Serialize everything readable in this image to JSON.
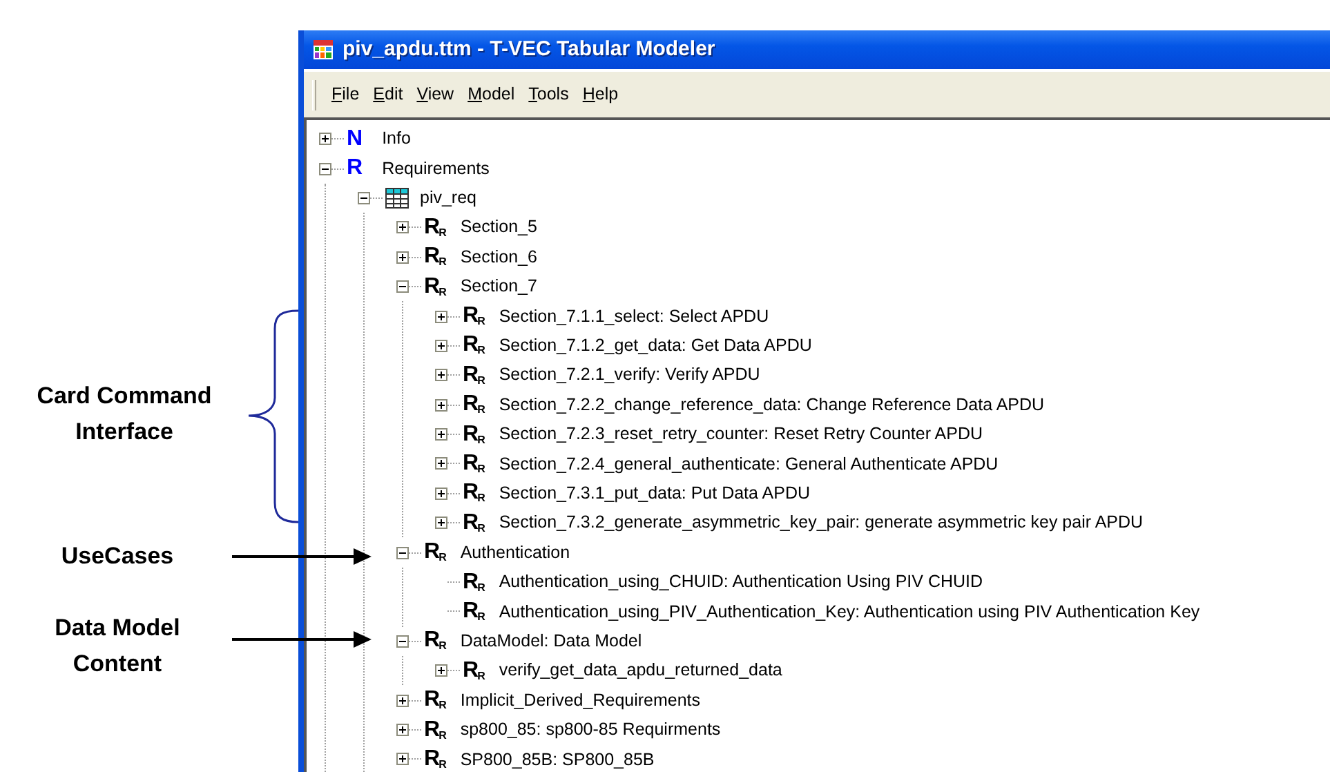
{
  "annotations": [
    {
      "kind": "brace",
      "text": "Card Command Interface"
    },
    {
      "kind": "arrow",
      "text": "UseCases"
    },
    {
      "kind": "arrow",
      "text": "Data Model Content"
    }
  ],
  "window": {
    "title": "piv_apdu.ttm - T-VEC Tabular Modeler"
  },
  "menu": [
    "File",
    "Edit",
    "View",
    "Model",
    "Tools",
    "Help"
  ],
  "tree": [
    {
      "label": "Info",
      "kind": "letter",
      "icon_text": "N",
      "color": "#0000ff",
      "expanded": false
    },
    {
      "label": "Requirements",
      "kind": "letter",
      "icon_text": "R",
      "color": "#0000ff",
      "expanded": true,
      "children": [
        {
          "label": "piv_req",
          "kind": "table",
          "expanded": true,
          "children": [
            {
              "label": "Section_5",
              "kind": "letter",
              "icon_text": "R",
              "icon_sub": "R",
              "color": "#000000",
              "expanded": false
            },
            {
              "label": "Section_6",
              "kind": "letter",
              "icon_text": "R",
              "icon_sub": "R",
              "color": "#000000",
              "expanded": false
            },
            {
              "label": "Section_7",
              "kind": "letter",
              "icon_text": "R",
              "icon_sub": "R",
              "color": "#000000",
              "expanded": true,
              "children": [
                {
                  "label": "Section_7.1.1_select: Select APDU",
                  "kind": "letter",
                  "icon_text": "R",
                  "icon_sub": "R",
                  "color": "#000000",
                  "expanded": false
                },
                {
                  "label": "Section_7.1.2_get_data: Get Data APDU",
                  "kind": "letter",
                  "icon_text": "R",
                  "icon_sub": "R",
                  "color": "#000000",
                  "expanded": false
                },
                {
                  "label": "Section_7.2.1_verify: Verify APDU",
                  "kind": "letter",
                  "icon_text": "R",
                  "icon_sub": "R",
                  "color": "#000000",
                  "expanded": false
                },
                {
                  "label": "Section_7.2.2_change_reference_data: Change Reference Data APDU",
                  "kind": "letter",
                  "icon_text": "R",
                  "icon_sub": "R",
                  "color": "#000000",
                  "expanded": false
                },
                {
                  "label": "Section_7.2.3_reset_retry_counter: Reset Retry Counter APDU",
                  "kind": "letter",
                  "icon_text": "R",
                  "icon_sub": "R",
                  "color": "#000000",
                  "expanded": false
                },
                {
                  "label": "Section_7.2.4_general_authenticate: General Authenticate APDU",
                  "kind": "letter",
                  "icon_text": "R",
                  "icon_sub": "R",
                  "color": "#000000",
                  "expanded": false
                },
                {
                  "label": "Section_7.3.1_put_data: Put Data APDU",
                  "kind": "letter",
                  "icon_text": "R",
                  "icon_sub": "R",
                  "color": "#000000",
                  "expanded": false
                },
                {
                  "label": "Section_7.3.2_generate_asymmetric_key_pair: generate asymmetric key pair APDU",
                  "kind": "letter",
                  "icon_text": "R",
                  "icon_sub": "R",
                  "color": "#000000",
                  "expanded": false
                }
              ]
            },
            {
              "label": "Authentication",
              "kind": "letter",
              "icon_text": "R",
              "icon_sub": "R",
              "color": "#000000",
              "expanded": true,
              "children": [
                {
                  "label": "Authentication_using_CHUID: Authentication Using PIV CHUID",
                  "kind": "letter",
                  "icon_text": "R",
                  "icon_sub": "R",
                  "color": "#000000"
                },
                {
                  "label": "Authentication_using_PIV_Authentication_Key: Authentication using PIV Authentication Key",
                  "kind": "letter",
                  "icon_text": "R",
                  "icon_sub": "R",
                  "color": "#000000"
                }
              ]
            },
            {
              "label": "DataModel: Data Model",
              "kind": "letter",
              "icon_text": "R",
              "icon_sub": "R",
              "color": "#000000",
              "expanded": true,
              "children": [
                {
                  "label": "verify_get_data_apdu_returned_data",
                  "kind": "letter",
                  "icon_text": "R",
                  "icon_sub": "R",
                  "color": "#000000",
                  "expanded": false
                }
              ]
            },
            {
              "label": "Implicit_Derived_Requirements",
              "kind": "letter",
              "icon_text": "R",
              "icon_sub": "R",
              "color": "#000000",
              "expanded": false
            },
            {
              "label": "sp800_85: sp800-85 Requirments",
              "kind": "letter",
              "icon_text": "R",
              "icon_sub": "R",
              "color": "#000000",
              "expanded": false
            },
            {
              "label": "SP800_85B: SP800_85B",
              "kind": "letter",
              "icon_text": "R",
              "icon_sub": "R",
              "color": "#000000",
              "expanded": false
            }
          ]
        }
      ]
    }
  ]
}
